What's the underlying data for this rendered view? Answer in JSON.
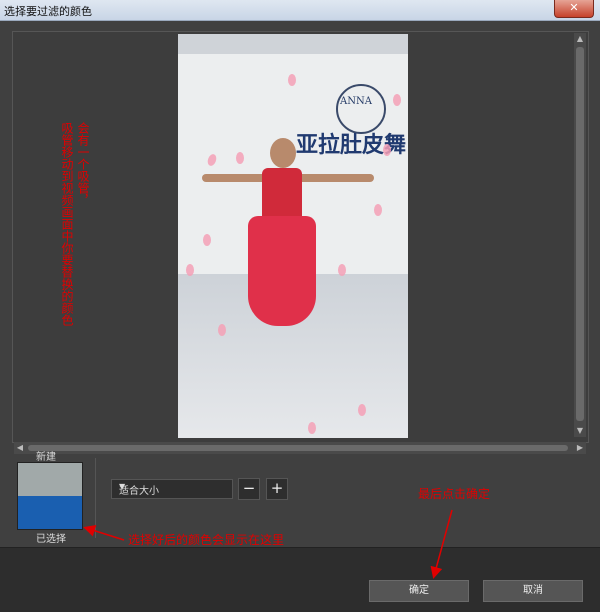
{
  "window": {
    "title": "选择要过滤的颜色",
    "close_glyph": "✕"
  },
  "preview": {
    "sign_text": "亚拉肚皮舞",
    "logo_text": "ANNA"
  },
  "annotations": {
    "vertical_1": "会有一个吸管，",
    "vertical_2": "吸管移动到视频画面中你要替换的颜色",
    "swatch_note": "选择好后的颜色会显示在这里",
    "ok_note": "最后点击确定"
  },
  "color_panel": {
    "new_label": "新建",
    "selected_label": "已选择",
    "new_color": "#a1a9a9",
    "selected_color": "#1a5fb0"
  },
  "zoom": {
    "select_value": "适合大小",
    "minus": "−",
    "plus": "+"
  },
  "buttons": {
    "ok": "确定",
    "cancel": "取消"
  },
  "scrollbar_glyphs": {
    "up": "▲",
    "down": "▼",
    "left": "◀",
    "right": "▶"
  }
}
